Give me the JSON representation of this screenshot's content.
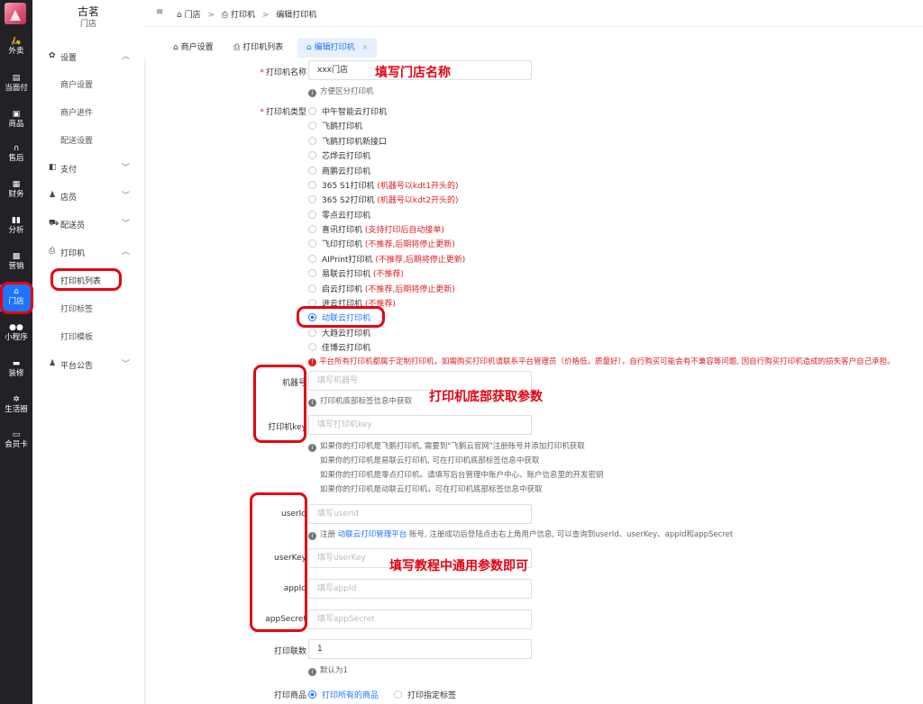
{
  "rail": {
    "items": [
      {
        "icon": "takeout-icon",
        "label": "外卖"
      },
      {
        "icon": "pay-icon",
        "label": "当面付"
      },
      {
        "icon": "goods-icon",
        "label": "商品"
      },
      {
        "icon": "aftersale-icon",
        "label": "售后"
      },
      {
        "icon": "finance-icon",
        "label": "财务"
      },
      {
        "icon": "analytics-icon",
        "label": "分析"
      },
      {
        "icon": "marketing-icon",
        "label": "营销"
      },
      {
        "icon": "store-icon",
        "label": "门店"
      },
      {
        "icon": "miniprogram-icon",
        "label": "小程序"
      },
      {
        "icon": "decorate-icon",
        "label": "装修"
      },
      {
        "icon": "lifecircle-icon",
        "label": "生活圈"
      },
      {
        "icon": "membercard-icon",
        "label": "会员卡"
      }
    ]
  },
  "brand": {
    "name": "古茗",
    "sub": "门店"
  },
  "subnav": {
    "settings": {
      "label": "设置",
      "children": [
        "商户设置",
        "商户进件",
        "配送设置"
      ]
    },
    "pay": {
      "label": "支付"
    },
    "staff": {
      "label": "店员"
    },
    "courier": {
      "label": "配送员"
    },
    "printer": {
      "label": "打印机",
      "children": [
        "打印机列表",
        "打印标签",
        "打印模板"
      ]
    },
    "notice": {
      "label": "平台公告"
    }
  },
  "breadcrumb": {
    "home": "门店",
    "sep": ">",
    "section": "打印机",
    "page": "编辑打印机"
  },
  "tabs": [
    {
      "label": "商户设置"
    },
    {
      "label": "打印机列表"
    },
    {
      "label": "编辑打印机",
      "close": "×"
    }
  ],
  "form": {
    "name": {
      "label": "打印机名称",
      "value": "xxx门店",
      "hint": "方便区分打印机"
    },
    "type": {
      "label": "打印机类型",
      "options": [
        {
          "name": "中午智能云打印机",
          "note": ""
        },
        {
          "name": "飞鹅打印机",
          "note": ""
        },
        {
          "name": "飞鹅打印机新接口",
          "note": ""
        },
        {
          "name": "芯烨云打印机",
          "note": ""
        },
        {
          "name": "商鹏云打印机",
          "note": ""
        },
        {
          "name": "365 S1打印机",
          "note": "(机器号以kdt1开头的)"
        },
        {
          "name": "365 S2打印机",
          "note": "(机器号以kdt2开头的)"
        },
        {
          "name": "零点云打印机",
          "note": ""
        },
        {
          "name": "喜讯打印机",
          "note": "(支持打印后自动接单)"
        },
        {
          "name": "飞印打印机",
          "note": "(不推荐,后期将停止更新)"
        },
        {
          "name": "AIPrint打印机",
          "note": "(不推荐,后期将停止更新)"
        },
        {
          "name": "易联云打印机",
          "note": "(不推荐)"
        },
        {
          "name": "启云打印机",
          "note": "(不推荐,后期将停止更新)"
        },
        {
          "name": "进云打印机",
          "note": "(不推荐)"
        },
        {
          "name": "动联云打印机",
          "note": ""
        },
        {
          "name": "大趋云打印机",
          "note": ""
        },
        {
          "name": "佳博云打印机",
          "note": ""
        }
      ],
      "selected_index": 14,
      "warning": "平台所有打印机都属于定制打印机，如需购买打印机请联系平台管理员（价格低，质量好），自行购买可能会有不兼容等问题, 因自行购买打印机造成的损失客户自己承担。"
    },
    "sn": {
      "label": "机器号",
      "placeholder": "填写机器号",
      "hint": "打印机底部标签信息中获取"
    },
    "key": {
      "label": "打印机key",
      "placeholder": "填写打印机key",
      "hints": [
        "如果你的打印机是飞鹅打印机, 需要到\"飞鹅云官网\"注册账号并添加打印机获取",
        "如果你的打印机是易联云打印机, 可在打印机底部标签信息中获取",
        "如果你的打印机是零点打印机。请填写后台管理中账户中心、账户信息里的开发密钥",
        "如果你的打印机是动联云打印机，可在打印机底部标签信息中获取"
      ],
      "hint_link": "\"飞鹅云官网\""
    },
    "userid": {
      "label": "userId",
      "placeholder": "填写userId",
      "hint_pre": "注册 ",
      "hint_link": "动联云打印管理平台",
      "hint_post": " 账号, 注册成功后登陆点击右上角用户信息, 可以查询到userId、userKey、appId和appSecret"
    },
    "userkey": {
      "label": "userKey",
      "placeholder": "填写userKey"
    },
    "appid": {
      "label": "appId",
      "placeholder": "填写appId"
    },
    "appsecret": {
      "label": "appSecret",
      "placeholder": "填写appSecret"
    },
    "copies": {
      "label": "打印联数",
      "value": "1",
      "hint": "默认为1"
    },
    "goods": {
      "label": "打印商品",
      "options": [
        "打印所有的商品",
        "打印指定标签"
      ],
      "selected_index": 0
    }
  },
  "annotations": {
    "fill_name": "填写门店名称",
    "bottom_params": "打印机底部获取参数",
    "tutorial_params": "填写教程中通用参数即可",
    "color": "#e60012"
  },
  "colors": {
    "accent": "#1e74ff",
    "rail": "#222226",
    "warning": "#e02020"
  }
}
